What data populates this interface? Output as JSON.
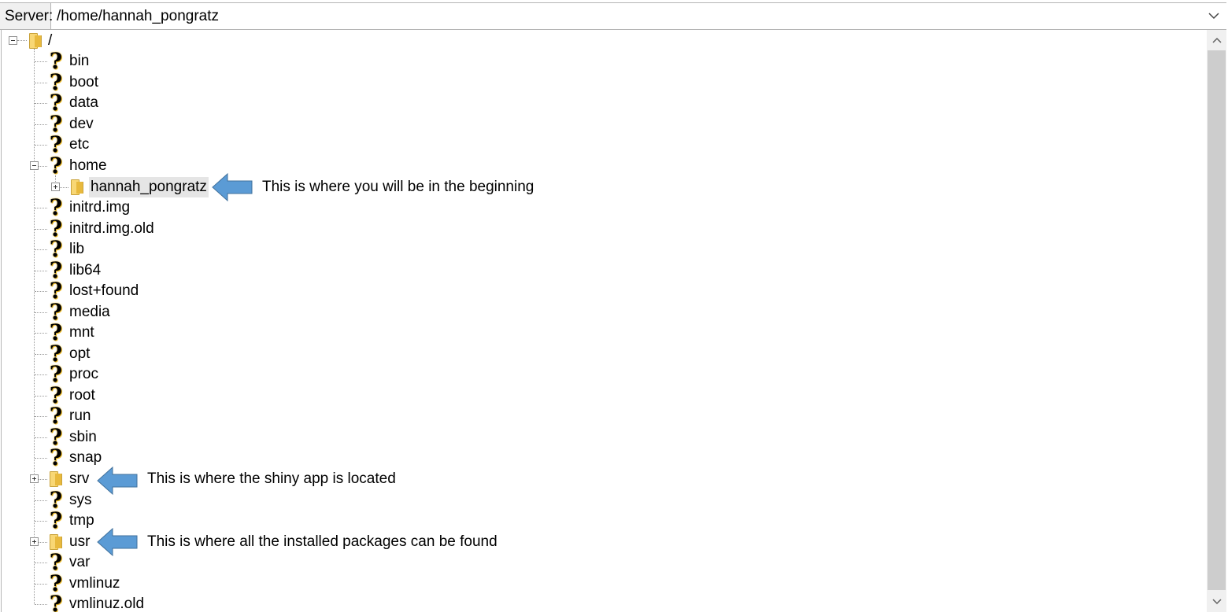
{
  "header": {
    "server_label": "Server:",
    "path_value": "/home/hannah_pongratz"
  },
  "tree": {
    "root": "/",
    "items": [
      {
        "label": "bin"
      },
      {
        "label": "boot"
      },
      {
        "label": "data"
      },
      {
        "label": "dev"
      },
      {
        "label": "etc"
      },
      {
        "label": "home"
      },
      {
        "label": "hannah_pongratz"
      },
      {
        "label": "initrd.img"
      },
      {
        "label": "initrd.img.old"
      },
      {
        "label": "lib"
      },
      {
        "label": "lib64"
      },
      {
        "label": "lost+found"
      },
      {
        "label": "media"
      },
      {
        "label": "mnt"
      },
      {
        "label": "opt"
      },
      {
        "label": "proc"
      },
      {
        "label": "root"
      },
      {
        "label": "run"
      },
      {
        "label": "sbin"
      },
      {
        "label": "snap"
      },
      {
        "label": "srv"
      },
      {
        "label": "sys"
      },
      {
        "label": "tmp"
      },
      {
        "label": "usr"
      },
      {
        "label": "var"
      },
      {
        "label": "vmlinuz"
      },
      {
        "label": "vmlinuz.old"
      }
    ]
  },
  "annotations": {
    "home_dir": "This is where you will be in the beginning",
    "srv_dir": "This is where the shiny app is located",
    "usr_dir": "This is where all the installed packages can be found"
  },
  "colors": {
    "arrow_fill": "#5b9bd5",
    "arrow_stroke": "#41719c",
    "folder": "#f8d775",
    "selection": "#e5e5e5"
  },
  "icons": {
    "unknown": "question-mark-icon",
    "folder": "folder-icon",
    "expand": "expand-plus-icon",
    "collapse": "collapse-minus-icon"
  }
}
